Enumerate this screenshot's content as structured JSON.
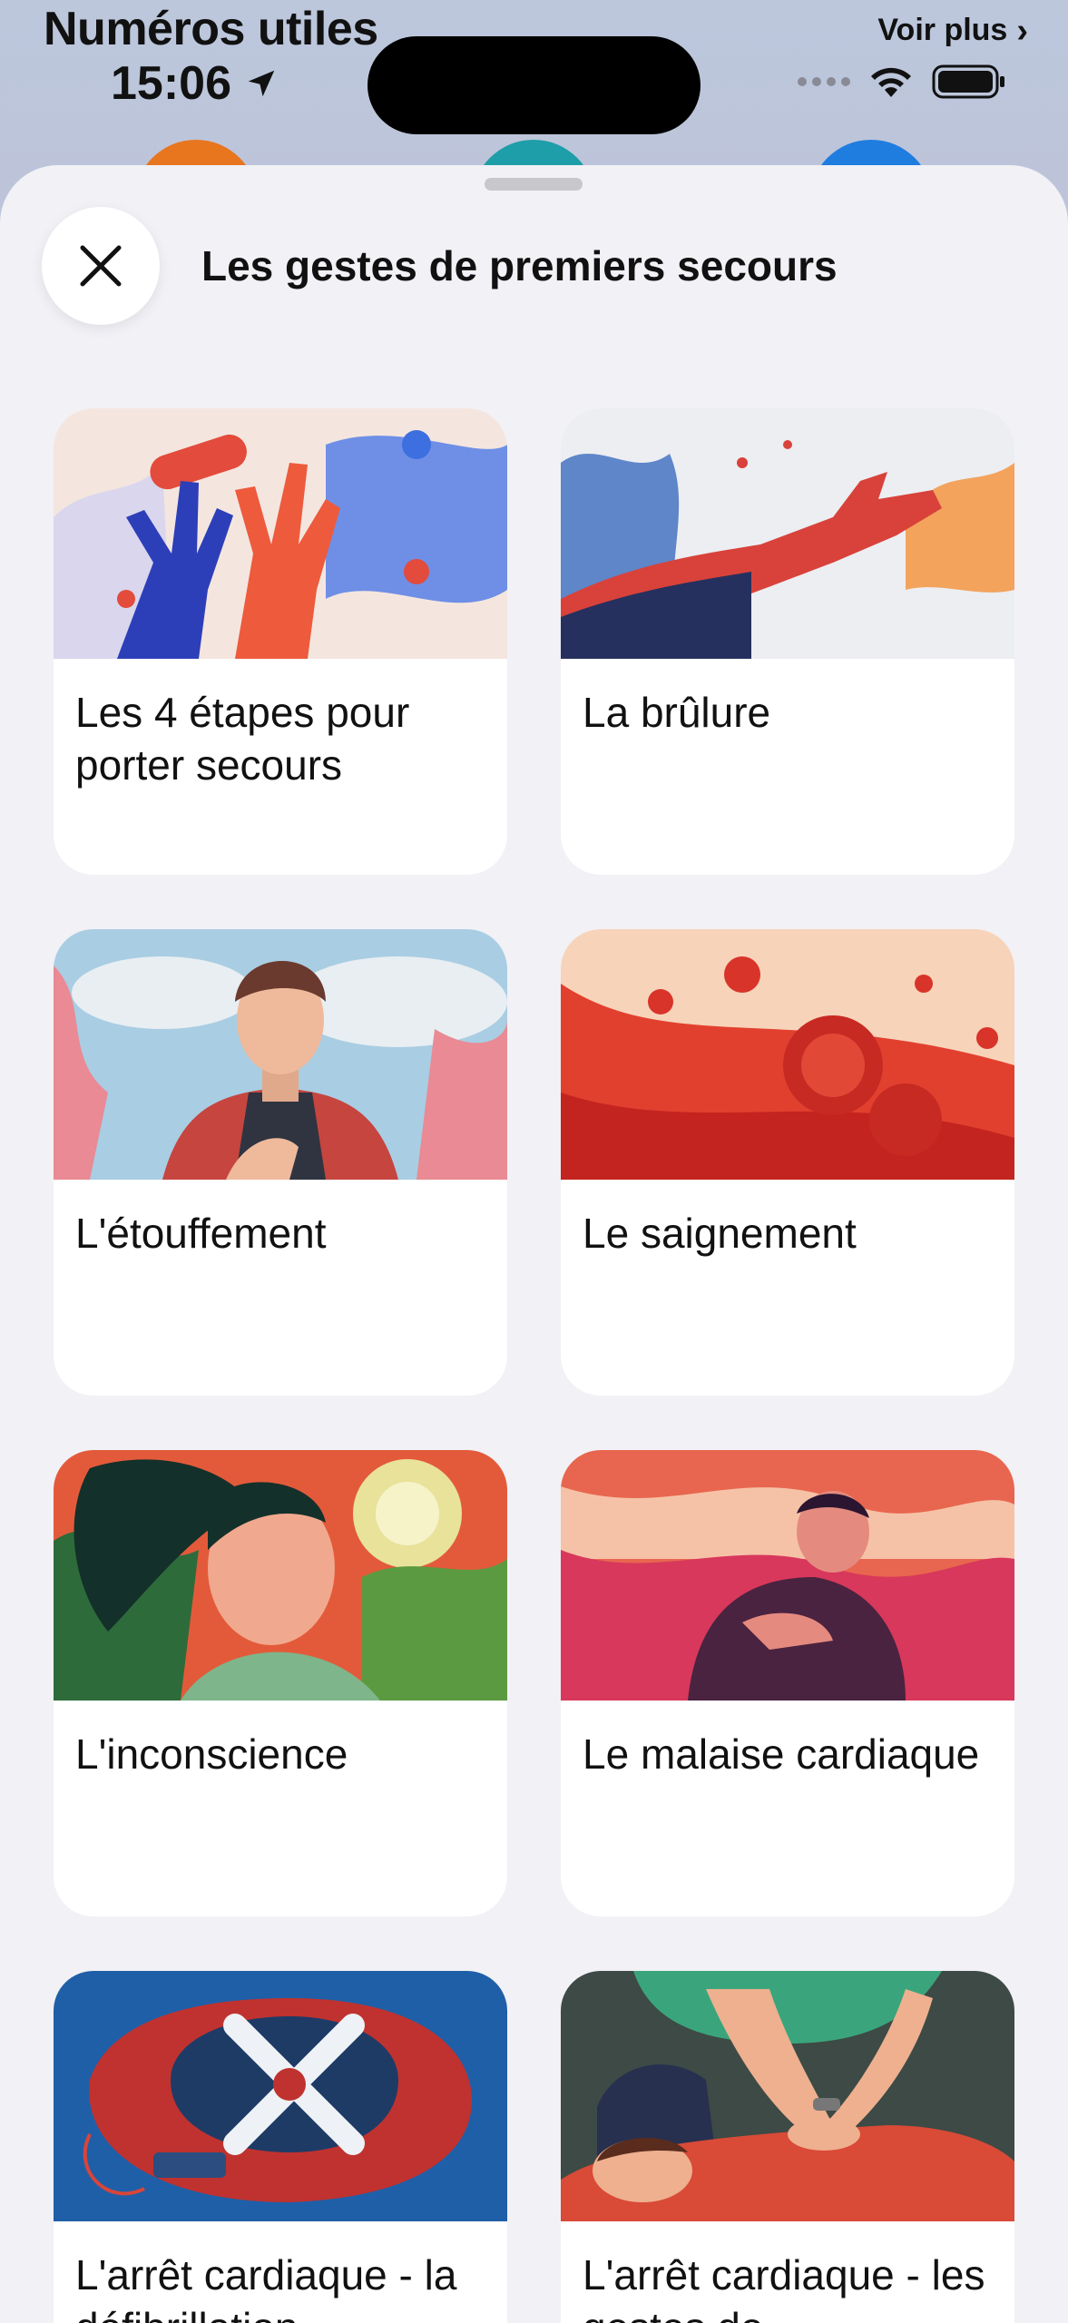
{
  "background": {
    "title": "Numéros utiles",
    "more_label": "Voir plus"
  },
  "status_bar": {
    "time": "15:06"
  },
  "sheet": {
    "title": "Les gestes de premiers secours",
    "cards": [
      {
        "label": "Les 4 étapes pour porter secours"
      },
      {
        "label": "La brûlure"
      },
      {
        "label": "L'étouffement"
      },
      {
        "label": "Le saignement"
      },
      {
        "label": "L'inconscience"
      },
      {
        "label": "Le malaise cardiaque"
      },
      {
        "label": "L'arrêt cardiaque - la défibrillation"
      },
      {
        "label": "L'arrêt cardiaque - les gestes de"
      }
    ]
  },
  "icons": {
    "close": "close-icon",
    "location": "location-arrow-icon",
    "wifi": "wifi-icon",
    "battery": "battery-icon",
    "chevron": "chevron-right-icon"
  }
}
